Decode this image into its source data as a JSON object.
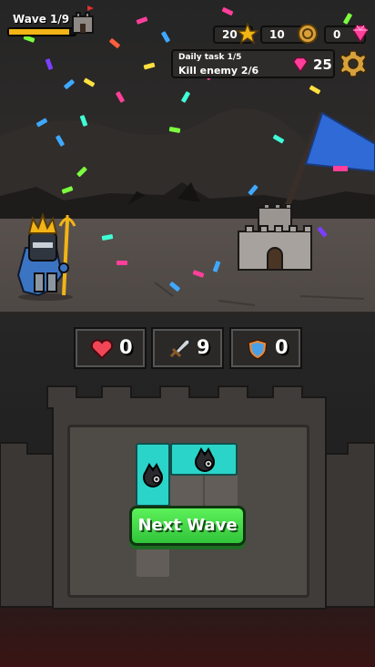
{
  "hud": {
    "wave_label": "Wave 1/9",
    "wave_progress": 0.92,
    "stars": "20",
    "coins": "10",
    "gems": "0"
  },
  "daily_task": {
    "title": "Daily task 1/5",
    "text": "Kill enemy 2/6",
    "reward": "25"
  },
  "stats": {
    "health": "0",
    "attack": "9",
    "shield": "0"
  },
  "actions": {
    "next_wave_label": "Next Wave"
  },
  "colors": {
    "accent_yellow": "#f2b416",
    "button_green": "#3ed646",
    "piece_teal": "#2ad4c8",
    "gem_pink": "#ff3f9a"
  },
  "icons": {
    "stars": "star-icon",
    "coins": "coin-icon",
    "gems": "gem-icon",
    "settings": "gear-icon",
    "health": "heart-icon",
    "attack": "sword-icon",
    "shield": "shield-icon"
  }
}
